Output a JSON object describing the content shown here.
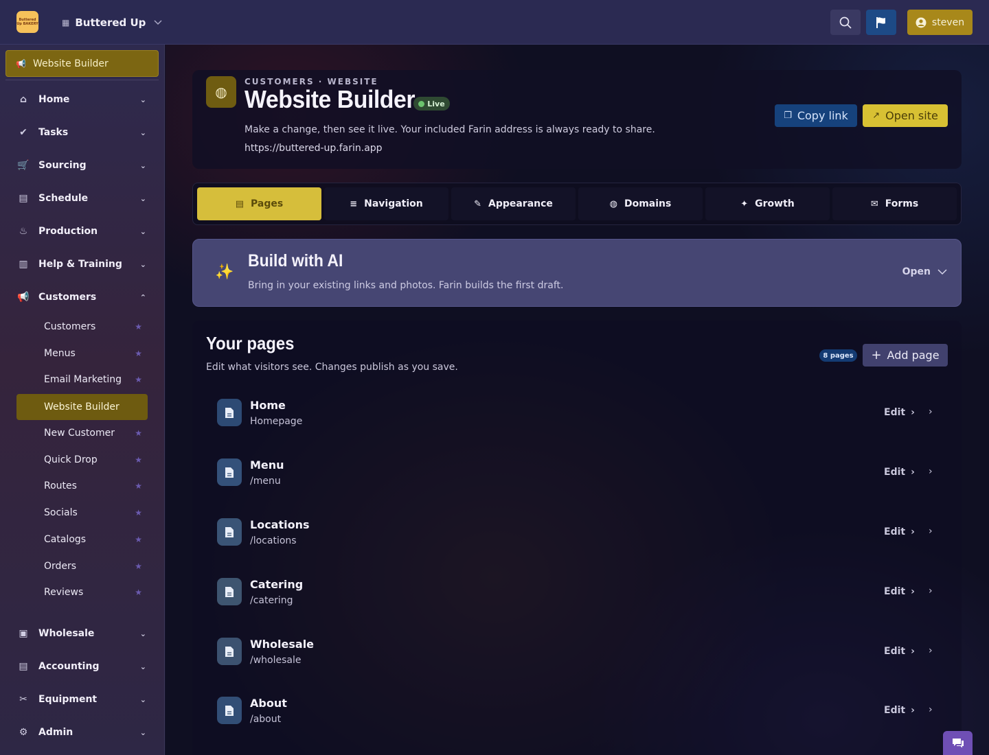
{
  "topbar": {
    "logo_text": "Buttered Up BAKERY",
    "org_name": "Buttered Up",
    "user_label": "steven",
    "icons": {
      "org": "building-icon",
      "search": "search-icon",
      "flag": "flag-icon",
      "user": "user-circle-icon"
    },
    "colors": {
      "user_button": "#a8881a",
      "flag_button": "#1d4a86"
    }
  },
  "sidebar": {
    "current": "Website Builder",
    "sections": [
      {
        "label": "Home",
        "icon": "home-icon"
      },
      {
        "label": "Tasks",
        "icon": "check-circle-icon"
      },
      {
        "label": "Sourcing",
        "icon": "cart-icon"
      },
      {
        "label": "Schedule",
        "icon": "calendar-icon"
      },
      {
        "label": "Production",
        "icon": "cake-icon"
      },
      {
        "label": "Help & Training",
        "icon": "book-icon"
      },
      {
        "label": "Customers",
        "icon": "megaphone-icon",
        "expanded": true
      }
    ],
    "customer_items": [
      {
        "label": "Customers"
      },
      {
        "label": "Menus"
      },
      {
        "label": "Email Marketing"
      },
      {
        "label": "Website Builder",
        "active": true
      },
      {
        "label": "New Customer"
      },
      {
        "label": "Quick Drop"
      },
      {
        "label": "Routes"
      },
      {
        "label": "Socials"
      },
      {
        "label": "Catalogs"
      },
      {
        "label": "Orders"
      },
      {
        "label": "Reviews"
      }
    ],
    "bottom_sections": [
      {
        "label": "Wholesale",
        "icon": "money-icon"
      },
      {
        "label": "Accounting",
        "icon": "ledger-icon"
      },
      {
        "label": "Equipment",
        "icon": "tools-icon"
      },
      {
        "label": "Admin",
        "icon": "gear-icon"
      }
    ]
  },
  "header": {
    "kicker": "CUSTOMERS · WEBSITE",
    "title": "Website Builder",
    "status": "Live",
    "description": "Make a change, then see it live. Your included Farin address is always ready to share.",
    "url": "https://buttered-up.farin.app",
    "copy_label": "Copy link",
    "open_label": "Open site"
  },
  "tabs": [
    {
      "label": "Pages",
      "icon": "file-icon",
      "active": true
    },
    {
      "label": "Navigation",
      "icon": "menu-icon"
    },
    {
      "label": "Appearance",
      "icon": "brush-icon"
    },
    {
      "label": "Domains",
      "icon": "globe-icon"
    },
    {
      "label": "Growth",
      "icon": "sparkle-icon"
    },
    {
      "label": "Forms",
      "icon": "envelope-icon"
    }
  ],
  "ai": {
    "title": "Build with AI",
    "subtitle": "Bring in your existing links and photos. Farin builds the first draft.",
    "toggle_label": "Open"
  },
  "pages": {
    "title": "Your pages",
    "subtitle": "Edit what visitors see. Changes publish as you save.",
    "count_badge": "8 pages",
    "add_label": "Add page",
    "edit_label": "Edit",
    "rows": [
      {
        "name": "Home",
        "path": "Homepage"
      },
      {
        "name": "Menu",
        "path": "/menu"
      },
      {
        "name": "Locations",
        "path": "/locations"
      },
      {
        "name": "Catering",
        "path": "/catering"
      },
      {
        "name": "Wholesale",
        "path": "/wholesale"
      },
      {
        "name": "About",
        "path": "/about"
      }
    ]
  }
}
